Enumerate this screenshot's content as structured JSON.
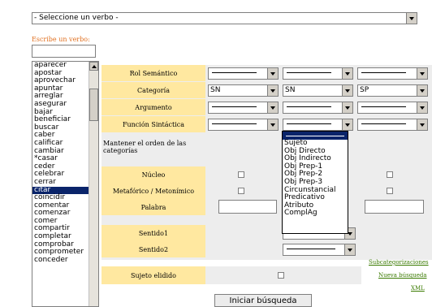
{
  "top_select": {
    "value": "- Seleccione un verbo -"
  },
  "verb_input": {
    "label": "Escribe un verbo:",
    "value": ""
  },
  "verb_list": {
    "items": [
      "aparecer",
      "apostar",
      "aprovechar",
      "apuntar",
      "arreglar",
      "asegurar",
      "bajar",
      "beneficiar",
      "buscar",
      "caber",
      "calificar",
      "cambiar",
      "*casar",
      "ceder",
      "celebrar",
      "cerrar",
      "citar",
      "coincidir",
      "comentar",
      "comenzar",
      "comer",
      "compartir",
      "completar",
      "comprobar",
      "comprometer",
      "conceder"
    ],
    "selected": "citar"
  },
  "form": {
    "rol_semantico": {
      "label": "Rol Semántico"
    },
    "categoria": {
      "label": "Categoría",
      "values": [
        "SN",
        "SN",
        "SP"
      ]
    },
    "argumento": {
      "label": "Argumento"
    },
    "funcion_sintactica": {
      "label": "Función Sintáctica",
      "open_options": [
        "Sujeto",
        "Obj Directo",
        "Obj Indirecto",
        "Obj Prep-1",
        "Obj Prep-2",
        "Obj Prep-3",
        "Circunstancial",
        "Predicativo",
        "Atributo",
        "ComplAg"
      ]
    },
    "mantener_orden": {
      "label": "Mantener el orden de las categorías"
    },
    "nucleo": {
      "label": "Núcleo"
    },
    "metaforico": {
      "label": "Metafórico / Metonímico"
    },
    "palabra": {
      "label": "Palabra"
    },
    "sentido1": {
      "label": "Sentido1"
    },
    "sentido2": {
      "label": "Sentido2"
    },
    "sujeto_elidido": {
      "label": "Sujeto elidido"
    }
  },
  "links": {
    "subcategorizaciones": "Subcategorizaciones",
    "nueva_busqueda": "Nueva búsqueda",
    "xml": "XML"
  },
  "search_button": {
    "label": "Iniciar búsqueda"
  },
  "colors": {
    "label_bg": "#ffe8a0",
    "panel_bg": "#ededed",
    "selection": "#0a246a",
    "link": "#3a7a00",
    "title_text": "#e07020"
  }
}
